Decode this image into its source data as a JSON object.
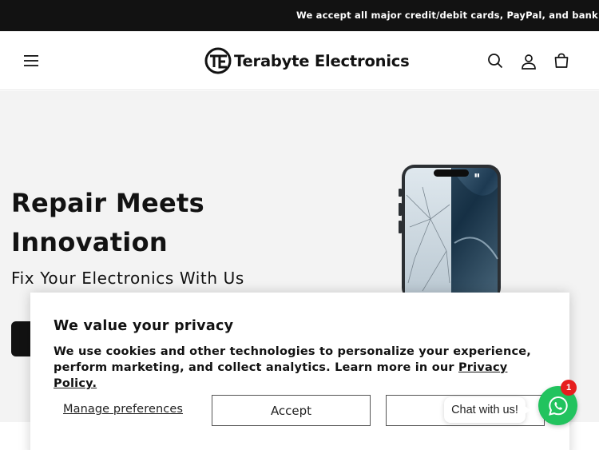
{
  "announcement": {
    "text": "We accept all major credit/debit cards, PayPal, and bank tra"
  },
  "header": {
    "brand_name": "Terabyte Electronics",
    "icons": [
      "menu-icon",
      "search-icon",
      "account-icon",
      "cart-icon"
    ]
  },
  "hero": {
    "title": "Repair Meets Innovation",
    "subtitle": "Fix Your Electronics With Us",
    "background_color": "#f3f3f3"
  },
  "cookie_banner": {
    "title": "We value your privacy",
    "body": "We use cookies and other technologies to personalize your experience, perform marketing, and collect analytics. Learn more in our ",
    "link_text": "Privacy Policy.",
    "manage_label": "Manage preferences",
    "accept_label": "Accept",
    "reject_label": "I"
  },
  "chat": {
    "bubble_text": "Chat with us!",
    "badge_count": "1",
    "button_color": "#22c35e"
  }
}
